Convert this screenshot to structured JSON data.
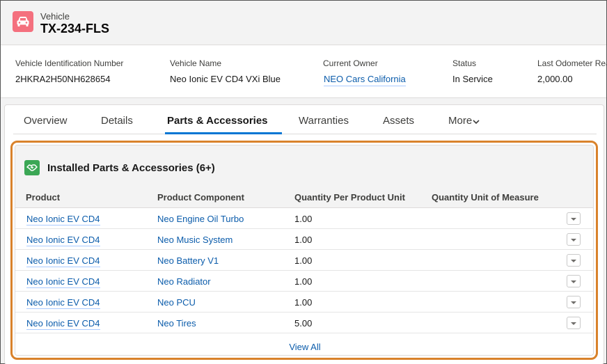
{
  "record": {
    "object_label": "Vehicle",
    "title": "TX-234-FLS",
    "icon": "car-icon",
    "icon_color": "#f4707e"
  },
  "highlights": [
    {
      "label": "Vehicle Identification Number",
      "value": "2HKRA2H50NH628654",
      "is_link": false
    },
    {
      "label": "Vehicle Name",
      "value": "Neo Ionic EV CD4 VXi Blue",
      "is_link": false
    },
    {
      "label": "Current Owner",
      "value": "NEO Cars California",
      "is_link": true
    },
    {
      "label": "Status",
      "value": "In Service",
      "is_link": false
    },
    {
      "label": "Last Odometer Read",
      "value": "2,000.00",
      "is_link": false
    }
  ],
  "tabs": [
    {
      "label": "Overview",
      "active": false
    },
    {
      "label": "Details",
      "active": false
    },
    {
      "label": "Parts & Accessories",
      "active": true
    },
    {
      "label": "Warranties",
      "active": false
    },
    {
      "label": "Assets",
      "active": false
    },
    {
      "label": "More",
      "active": false
    }
  ],
  "related_list": {
    "title": "Installed Parts & Accessories (6+)",
    "icon": "handshake-icon",
    "icon_color": "#3ba755",
    "highlight_color": "#d9822b",
    "columns": [
      "Product",
      "Product Component",
      "Quantity Per Product Unit",
      "Quantity Unit of Measure"
    ],
    "rows": [
      {
        "product": "Neo Ionic EV CD4",
        "component": "Neo Engine Oil Turbo",
        "qty": "1.00",
        "uom": ""
      },
      {
        "product": "Neo Ionic EV CD4",
        "component": "Neo Music System",
        "qty": "1.00",
        "uom": ""
      },
      {
        "product": "Neo Ionic EV CD4",
        "component": "Neo Battery V1",
        "qty": "1.00",
        "uom": ""
      },
      {
        "product": "Neo Ionic EV CD4",
        "component": "Neo Radiator",
        "qty": "1.00",
        "uom": ""
      },
      {
        "product": "Neo Ionic EV CD4",
        "component": "Neo PCU",
        "qty": "1.00",
        "uom": ""
      },
      {
        "product": "Neo Ionic EV CD4",
        "component": "Neo Tires",
        "qty": "5.00",
        "uom": ""
      }
    ],
    "view_all_label": "View All"
  }
}
